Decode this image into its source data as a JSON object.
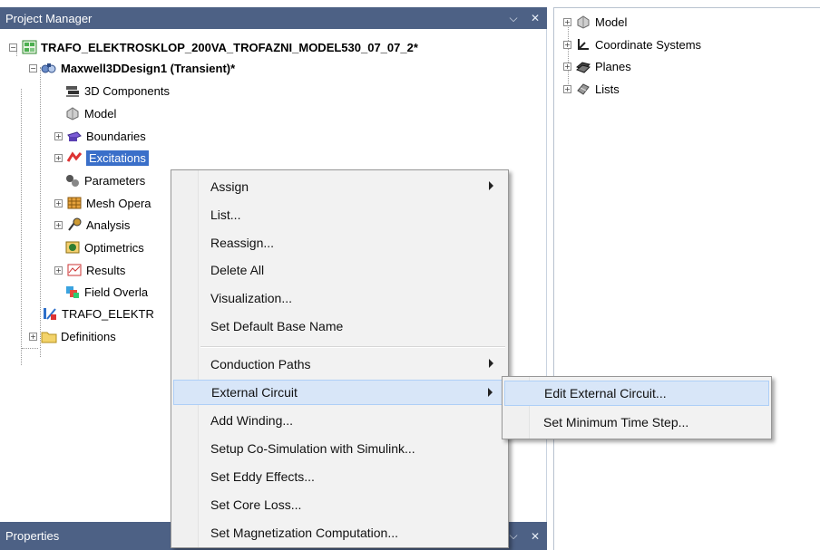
{
  "project_manager": {
    "title": "Project Manager",
    "pin_glyph": "⌵",
    "close_glyph": "✕",
    "tree": {
      "project": "TRAFO_ELEKTROSKLOP_200VA_TROFAZNI_MODEL530_07_07_2*",
      "design": "Maxwell3DDesign1 (Transient)*",
      "items": [
        {
          "label": "3D Components",
          "icon": "3d-components-icon"
        },
        {
          "label": "Model",
          "icon": "model-icon"
        },
        {
          "label": "Boundaries",
          "icon": "boundaries-icon"
        },
        {
          "label": "Excitations",
          "icon": "excitations-icon"
        },
        {
          "label": "Parameters",
          "icon": "parameters-icon"
        },
        {
          "label": "Mesh Opera",
          "icon": "mesh-icon"
        },
        {
          "label": "Analysis",
          "icon": "analysis-icon"
        },
        {
          "label": "Optimetrics",
          "icon": "optimetrics-icon"
        },
        {
          "label": "Results",
          "icon": "results-icon"
        },
        {
          "label": "Field Overla",
          "icon": "field-overlays-icon"
        }
      ],
      "schematic": "TRAFO_ELEKTR",
      "definitions": "Definitions"
    }
  },
  "properties": {
    "title": "Properties",
    "pin_glyph": "⌵",
    "close_glyph": "✕"
  },
  "model_tree": {
    "items": [
      {
        "label": "Model",
        "icon": "model-icon"
      },
      {
        "label": "Coordinate Systems",
        "icon": "coordinate-systems-icon"
      },
      {
        "label": "Planes",
        "icon": "planes-icon"
      },
      {
        "label": "Lists",
        "icon": "lists-icon"
      }
    ]
  },
  "context_menu": {
    "items": [
      {
        "label": "Assign",
        "submenu": true
      },
      {
        "label": "List..."
      },
      {
        "label": "Reassign..."
      },
      {
        "label": "Delete All"
      },
      {
        "label": "Visualization..."
      },
      {
        "label": "Set Default Base Name"
      },
      {
        "label": "Conduction Paths",
        "submenu": true
      },
      {
        "label": "External Circuit",
        "submenu": true,
        "highlighted": true
      },
      {
        "label": "Add Winding..."
      },
      {
        "label": "Setup Co-Simulation with Simulink..."
      },
      {
        "label": "Set Eddy Effects..."
      },
      {
        "label": "Set Core Loss..."
      },
      {
        "label": "Set Magnetization Computation..."
      }
    ]
  },
  "submenu": {
    "items": [
      {
        "label": "Edit External Circuit...",
        "highlighted": true
      },
      {
        "label": "Set Minimum Time Step..."
      }
    ]
  },
  "colors": {
    "titlebar": "#4d6185",
    "selection": "#3a6fc9",
    "menu_highlight": "#d8e6f8"
  }
}
